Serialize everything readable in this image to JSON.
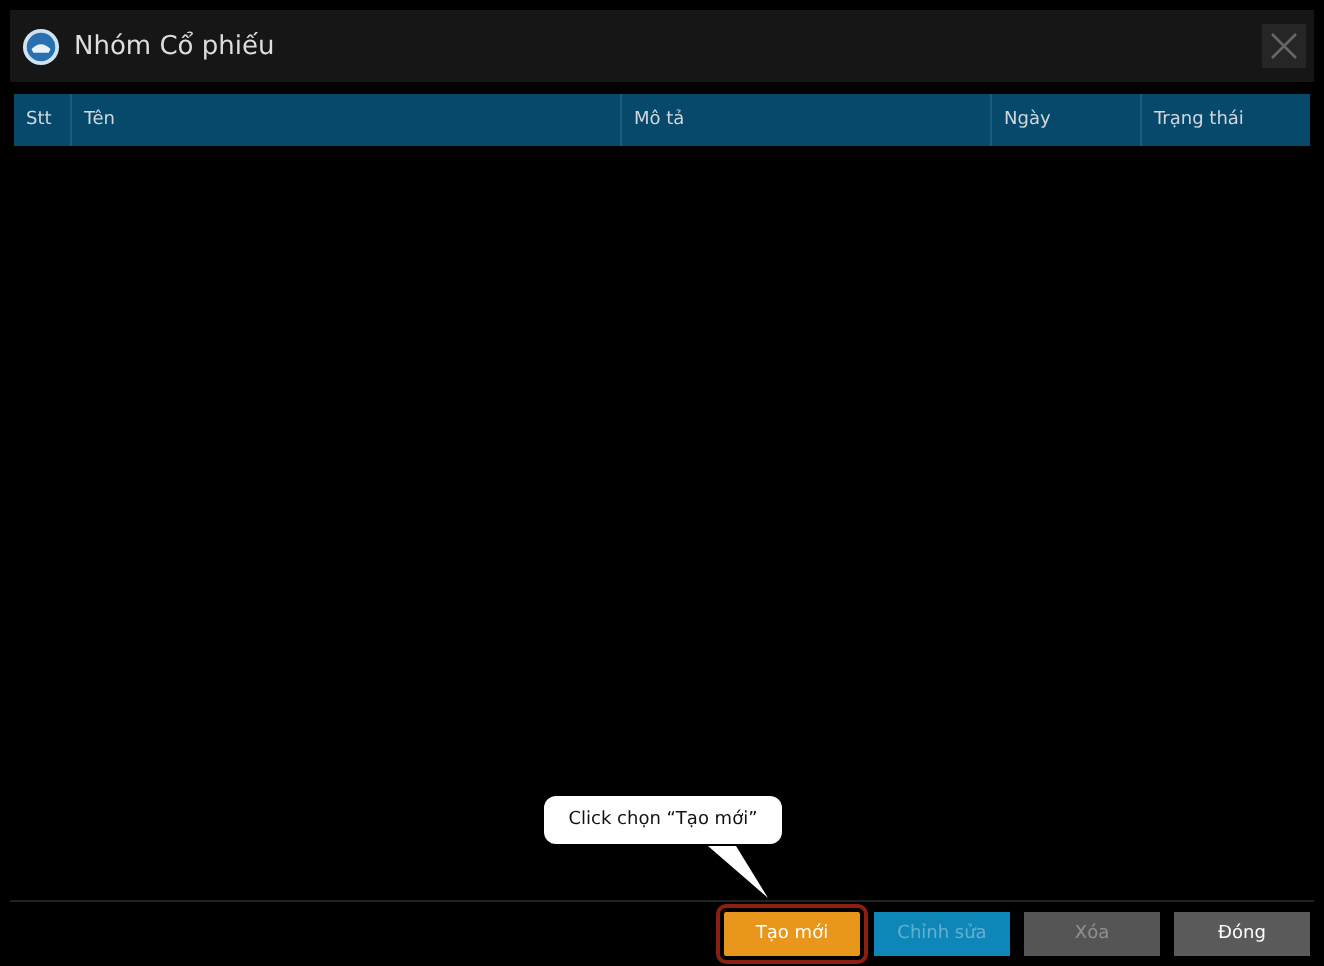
{
  "window": {
    "title": "Nhóm Cổ phiếu"
  },
  "table": {
    "columns": [
      "Stt",
      "Tên",
      "Mô tả",
      "Ngày",
      "Trạng thái"
    ]
  },
  "callout": {
    "text": "Click chọn “Tạo mới”"
  },
  "buttons": [
    {
      "label": "Tạo mới",
      "kind": "create",
      "disabled": false,
      "highlighted": true
    },
    {
      "label": "Chỉnh sửa",
      "kind": "edit",
      "disabled": true,
      "highlighted": false
    },
    {
      "label": "Xóa",
      "kind": "delete",
      "disabled": true,
      "highlighted": false
    },
    {
      "label": "Đóng",
      "kind": "close",
      "disabled": false,
      "highlighted": false
    }
  ]
}
